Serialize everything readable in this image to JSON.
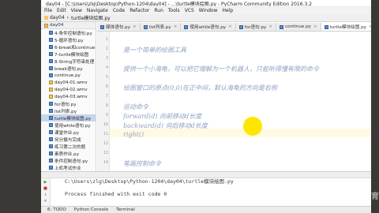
{
  "window": {
    "title": "day04 - [C:\\Users\\zlg\\Desktop\\Python-1204\\day04] - ...\\turtle模块绘图.py - PyCharm Community Edition 2016.3.2"
  },
  "menu": [
    "File",
    "Edit",
    "View",
    "Navigate",
    "Code",
    "Refactor",
    "Run",
    "Tools",
    "VCS",
    "Window",
    "Help"
  ],
  "nav": {
    "project": "day04",
    "file": "turtle模块绘图.py"
  },
  "project_panel": {
    "header": "day04",
    "items": [
      {
        "label": "4-条件控制语句.py",
        "type": "py"
      },
      {
        "label": "5-循环语句.py",
        "type": "py"
      },
      {
        "label": "6-break和continue语句",
        "type": "py"
      },
      {
        "label": "7-turtle模块绘图",
        "type": "py"
      },
      {
        "label": "8-String字符串处理",
        "type": "py"
      },
      {
        "label": "break语句.py",
        "type": "py"
      },
      {
        "label": "continue.py",
        "type": "py"
      },
      {
        "label": "day04-01.wmv",
        "type": "file"
      },
      {
        "label": "day04-02.wmv",
        "type": "file"
      },
      {
        "label": "day04-03.wmv",
        "type": "file"
      },
      {
        "label": "for语句.py",
        "type": "py"
      },
      {
        "label": "list列表.py",
        "type": "py"
      },
      {
        "label": "turtle模块绘图.py",
        "type": "py",
        "selected": true
      },
      {
        "label": "使用while语句.py",
        "type": "py"
      },
      {
        "label": "课堂作业.py",
        "type": "py"
      },
      {
        "label": "何分摄与完成",
        "type": "py"
      },
      {
        "label": "练习第二次的题",
        "type": "py"
      },
      {
        "label": "素质作业.py",
        "type": "py"
      },
      {
        "label": "条件控制语句.py",
        "type": "py"
      },
      {
        "label": "上机考试作业",
        "type": "py"
      }
    ]
  },
  "editor_tabs": [
    {
      "label": "媒体语句.py",
      "active": false
    },
    {
      "label": "list列表.py",
      "active": false
    },
    {
      "label": "使用while语句.py",
      "active": false
    },
    {
      "label": "for语句.py",
      "active": false
    },
    {
      "label": "continue.py",
      "active": false
    },
    {
      "label": "turtle模块绘图.py",
      "active": true
    }
  ],
  "code_lines": [
    {
      "n": "1",
      "text": ""
    },
    {
      "n": "2",
      "text": "是一个简单的绘图工具"
    },
    {
      "n": "3",
      "text": ""
    },
    {
      "n": "4",
      "text": "提供一个小海龟，可以把它理解为一个机器人，只能听得懂有限的命令"
    },
    {
      "n": "5",
      "text": ""
    },
    {
      "n": "6",
      "text": "绘图窗口的原点(0,0)在正中间，默认海龟的方向是右侧"
    },
    {
      "n": "7",
      "text": ""
    },
    {
      "n": "8",
      "text": "运动命令"
    },
    {
      "n": "9",
      "text": "forward(d)    向前移动d长度"
    },
    {
      "n": "10",
      "text": "backward(d)  向后移动d长度"
    },
    {
      "n": "11",
      "text": "right()"
    },
    {
      "n": "12",
      "text": ""
    },
    {
      "n": "13",
      "text": ""
    },
    {
      "n": "14",
      "text": "笔画控制命令"
    }
  ],
  "run_output": {
    "path": "C:\\Users\\zlg\\Desktop\\Python-1204\\day04\\turtle模块绘图.py",
    "exit": "Process finished with exit code 0"
  },
  "status_bar": [
    "6: TODO",
    "Python Console",
    "Terminal"
  ],
  "watermark": "千锋教育"
}
